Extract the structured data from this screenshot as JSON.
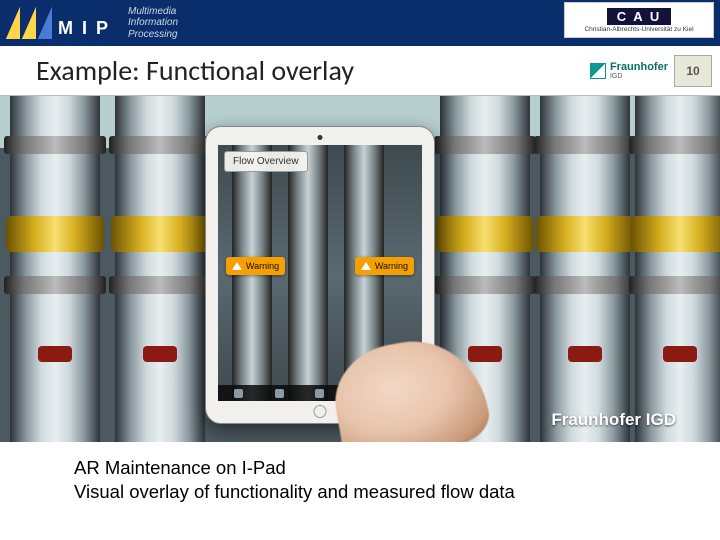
{
  "header": {
    "logo_letters": "M I P",
    "logo_sub_line1": "Multimedia",
    "logo_sub_line2": "Information",
    "logo_sub_line3": "Processing",
    "cau_label": "C A U",
    "cau_sub": "Christian-Albrechts-Universität zu Kiel"
  },
  "title_row": {
    "slide_title": "Example: Functional overlay",
    "fraunhofer_label": "Fraunhofer",
    "fraunhofer_sub": "IGD",
    "anniversary_badge": "10"
  },
  "photo": {
    "credit": "Fraunhofer IGD",
    "ipad": {
      "panel_label": "Flow Overview",
      "overlay_left_status": "Warning",
      "overlay_right_status": "Warning"
    }
  },
  "caption": {
    "line1": "AR Maintenance on I-Pad",
    "line2": "Visual overlay of functionality and measured flow data"
  }
}
